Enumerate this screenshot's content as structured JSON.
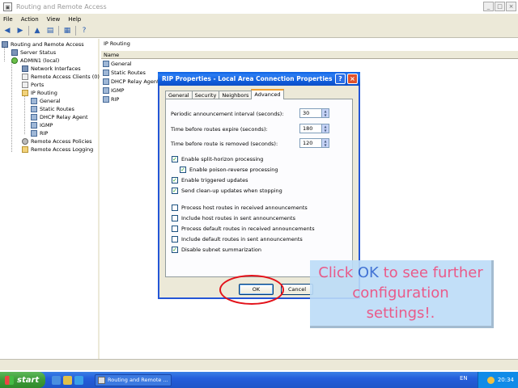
{
  "window": {
    "title": "Routing and Remote Access",
    "buttons": [
      "_",
      "□",
      "×"
    ]
  },
  "menu": [
    "File",
    "Action",
    "View",
    "Help"
  ],
  "tree": [
    {
      "label": "Routing and Remote Access",
      "icon": "server-icon"
    },
    {
      "label": "Server Status",
      "icon": "server-icon"
    },
    {
      "label": "ADMIN1 (local)",
      "icon": "server-green-icon"
    },
    {
      "label": "Network Interfaces",
      "icon": "network-icon"
    },
    {
      "label": "Remote Access Clients (0)",
      "icon": "clients-icon"
    },
    {
      "label": "Ports",
      "icon": "ports-icon"
    },
    {
      "label": "IP Routing",
      "icon": "folder-icon"
    },
    {
      "label": "General",
      "icon": "route-icon"
    },
    {
      "label": "Static Routes",
      "icon": "route-icon"
    },
    {
      "label": "DHCP Relay Agent",
      "icon": "route-icon"
    },
    {
      "label": "IGMP",
      "icon": "route-icon"
    },
    {
      "label": "RIP",
      "icon": "route-icon"
    },
    {
      "label": "Remote Access Policies",
      "icon": "policy-icon"
    },
    {
      "label": "Remote Access Logging",
      "icon": "folder-icon"
    }
  ],
  "right_pane": {
    "header": "IP Routing",
    "column": "Name",
    "items": [
      "General",
      "Static Routes",
      "DHCP Relay Agent",
      "IGMP",
      "RIP"
    ]
  },
  "dialog": {
    "title": "RIP Properties - Local Area Connection Properties",
    "help_label": "?",
    "close_label": "×",
    "tabs": [
      "General",
      "Security",
      "Neighbors",
      "Advanced"
    ],
    "active_tab": "Advanced",
    "fields": [
      {
        "label": "Periodic announcement interval (seconds):",
        "value": "30"
      },
      {
        "label": "Time before routes expire (seconds):",
        "value": "180"
      },
      {
        "label": "Time before route is removed (seconds):",
        "value": "120"
      }
    ],
    "checkboxes": [
      {
        "label": "Enable split-horizon processing",
        "checked": true
      },
      {
        "label": "Enable poison-reverse processing",
        "checked": true
      },
      {
        "label": "Enable triggered updates",
        "checked": true
      },
      {
        "label": "Send clean-up updates when stopping",
        "checked": true
      },
      {
        "label": "Process host routes in received announcements",
        "checked": false
      },
      {
        "label": "Include host routes in sent announcements",
        "checked": false
      },
      {
        "label": "Process default routes in received announcements",
        "checked": false
      },
      {
        "label": "Include default routes in sent announcements",
        "checked": false
      },
      {
        "label": "Disable subnet summarization",
        "checked": true
      }
    ],
    "ok_label": "OK",
    "cancel_label": "Cancel"
  },
  "callout": {
    "pre": "Click",
    "ok": "OK",
    "post": "to see further configuration settings!."
  },
  "taskbar": {
    "start_label": "start",
    "task_label": "Routing and Remote ...",
    "lang": "EN",
    "clock": "20:34"
  },
  "colors": {
    "dialog_title": "#0f5bd9",
    "callout_bg": "#bcdcf8",
    "callout_text": "#e8497d",
    "callout_ok": "#2e64d0",
    "highlight_ellipse": "#e3121a"
  }
}
